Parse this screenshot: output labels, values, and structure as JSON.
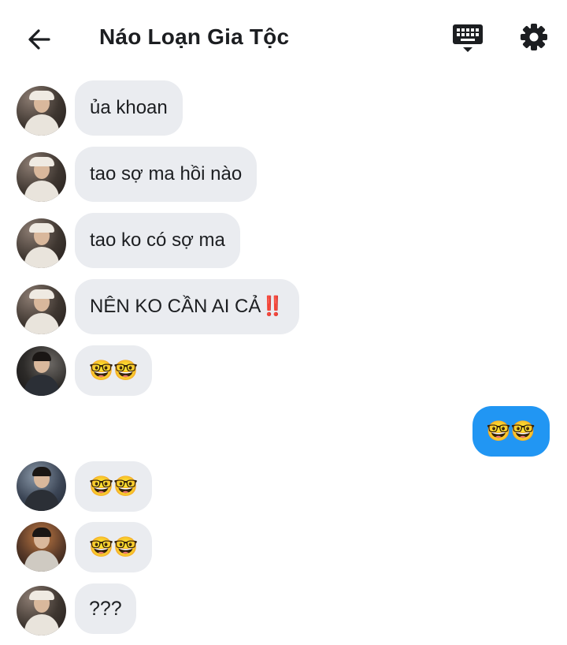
{
  "header": {
    "title": "Náo Loạn Gia Tộc",
    "icons": {
      "back": "back-arrow-icon",
      "keyboard": "keyboard-icon",
      "settings": "gear-icon"
    }
  },
  "messages": [
    {
      "text": "ủa khoan"
    },
    {
      "text": "tao sợ ma hồi nào"
    },
    {
      "text": "tao ko có sợ ma"
    },
    {
      "text": "NÊN KO CẦN AI CẢ",
      "suffix": "‼️"
    },
    {
      "text": "🤓🤓"
    },
    {
      "text": "🤓🤓"
    },
    {
      "text": "🤓🤓"
    },
    {
      "text": "🤓🤓"
    },
    {
      "text": "???"
    }
  ],
  "colors": {
    "incoming_bubble": "#eaecf0",
    "outgoing_bubble": "#2196f3",
    "text": "#1c1e21"
  }
}
